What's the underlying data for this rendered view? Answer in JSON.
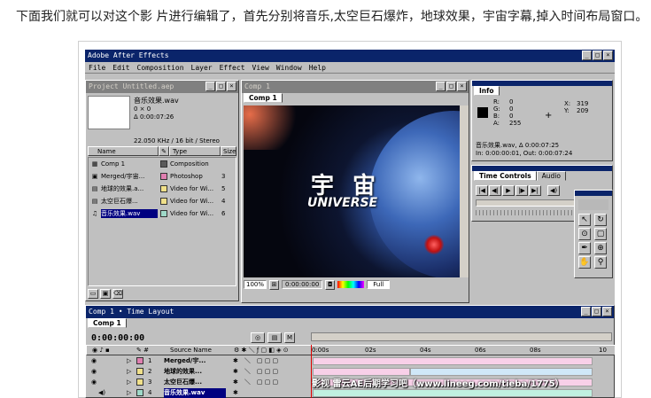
{
  "caption": "下面我们就可以对这个影 片进行编辑了，首先分别将音乐,太空巨石爆炸，地球效果，宇宙字幕,掉入时间布局窗口。",
  "app": {
    "title": "Adobe After Effects"
  },
  "menu": [
    "File",
    "Edit",
    "Composition",
    "Layer",
    "Effect",
    "View",
    "Window",
    "Help"
  ],
  "project": {
    "title": "Project Untitled.aep",
    "selected_name": "音乐效果.wav",
    "dims": "0 × 0",
    "duration": "Δ 0:00:07:26",
    "audio_info": "22.050 KHz / 16 bit / Stereo",
    "col_name": "Name",
    "col_type": "Type",
    "col_size": "Size",
    "items": [
      {
        "name": "Comp 1",
        "type": "Composition",
        "size": "",
        "color": "#5a5a5a",
        "icon": "▦"
      },
      {
        "name": "Merged/宇宙...",
        "type": "Photoshop",
        "size": "3",
        "color": "#e07fb0",
        "icon": "▣"
      },
      {
        "name": "地球的效果.a...",
        "type": "Video for Wi...",
        "size": "5",
        "color": "#f0e08a",
        "icon": "▤"
      },
      {
        "name": "太空巨石爆...",
        "type": "Video for Wi...",
        "size": "4",
        "color": "#f0e08a",
        "icon": "▤"
      },
      {
        "name": "音乐效果.wav",
        "type": "Video for Wi...",
        "size": "6",
        "color": "#9fd8c8",
        "icon": "♫"
      }
    ]
  },
  "comp_window": {
    "title": "Comp 1",
    "tab": "Comp 1",
    "title_cn": "宇 宙",
    "title_en": "UNIVERSE",
    "zoom": "100%",
    "timecode": "0:00:00:00",
    "quality": "Full"
  },
  "info": {
    "tab": "Info",
    "r": "0",
    "g": "0",
    "b": "0",
    "a": "255",
    "x": "319",
    "y": "209",
    "line1": "音乐效果.wav, Δ 0:00:07:25",
    "line2": "In: 0:00:00:01, Out: 0:00:07:24"
  },
  "time_controls": {
    "tab": "Time Controls",
    "tab2": "Audio"
  },
  "timeline": {
    "title": "Comp 1 • Time Layout",
    "tab": "Comp 1",
    "timecode": "0:00:00:00",
    "col_source": "Source Name",
    "ticks": [
      "0:00s",
      "02s",
      "04s",
      "06s",
      "08s",
      "10"
    ],
    "layers": [
      {
        "num": "1",
        "name": "Merged/宇...",
        "color": "#e07fb0"
      },
      {
        "num": "2",
        "name": "地球的效果...",
        "color": "#f0e08a"
      },
      {
        "num": "3",
        "name": "太空巨石爆...",
        "color": "#f0e08a"
      },
      {
        "num": "4",
        "name": "音乐效果.wav",
        "color": "#9fd8c8"
      }
    ]
  },
  "watermark": "影视 雷云AE后期学习吧（www.lineeg.com/tieba/1775）",
  "colors": {
    "titlebar": "#0a246a",
    "panel": "#c0c0c0",
    "timebar": "#f8d0e8"
  }
}
